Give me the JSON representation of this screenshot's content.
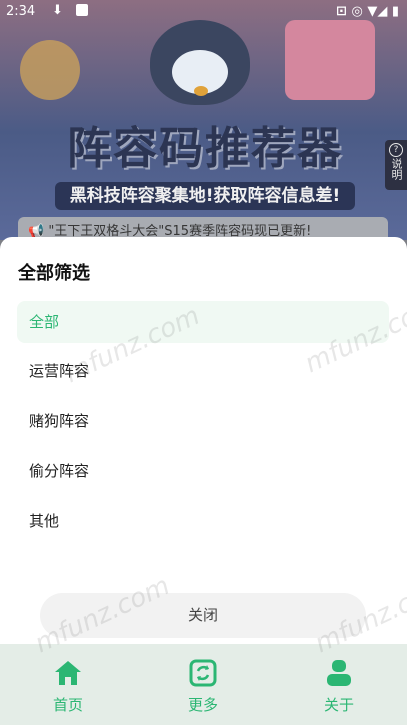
{
  "status_bar": {
    "time": "2:34",
    "download_icon": "download-icon",
    "app_icon": "app-icon",
    "right_text": "⊡ ◎ ▼◢ ▮"
  },
  "banner": {
    "title": "阵容码推荐器",
    "subtitle": "黑科技阵容聚集地!获取阵容信息差!",
    "side_tab_label": "说明"
  },
  "notice": {
    "text": "📢 \"王下王双格斗大会\"S15赛季阵容码现已更新!"
  },
  "filter_sheet": {
    "title": "全部筛选",
    "options": [
      {
        "label": "全部",
        "selected": true
      },
      {
        "label": "运营阵容",
        "selected": false
      },
      {
        "label": "赌狗阵容",
        "selected": false
      },
      {
        "label": "偷分阵容",
        "selected": false
      },
      {
        "label": "其他",
        "selected": false
      }
    ],
    "close_label": "关闭"
  },
  "tab_bar": {
    "items": [
      {
        "label": "首页",
        "icon": "home-icon"
      },
      {
        "label": "更多",
        "icon": "refresh-icon"
      },
      {
        "label": "关于",
        "icon": "user-icon"
      }
    ]
  },
  "colors": {
    "accent": "#2bb673",
    "selected_bg": "#f0f9f3",
    "tabbar_bg": "#e4ede7"
  },
  "watermark": "mfunz.com"
}
